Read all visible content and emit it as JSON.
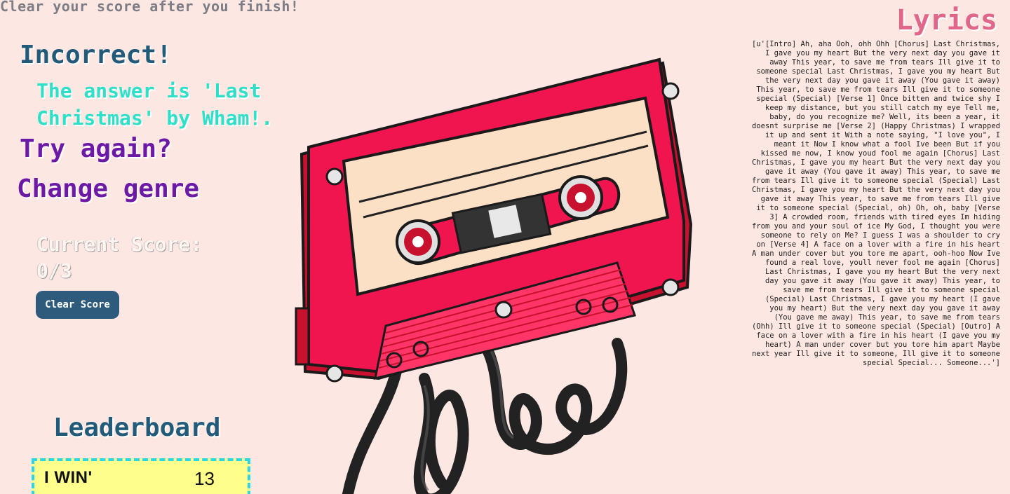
{
  "header": {
    "note": "Clear your score after you finish!"
  },
  "result": {
    "title": "Incorrect!",
    "answer": "The answer is 'Last Christmas' by Wham!."
  },
  "actions": {
    "try_again": "Try again?",
    "change_genre": "Change genre"
  },
  "score": {
    "label": "Current Score: 0/3",
    "clear_button": "Clear Score"
  },
  "leaderboard": {
    "title": "Leaderboard",
    "entries": [
      {
        "name": "I WIN'",
        "score": "13"
      }
    ]
  },
  "lyrics": {
    "title": "Lyrics",
    "text": "[u'[Intro] Ah, aha Ooh, ohh Ohh [Chorus] Last Christmas, I gave you my heart But the very next day you gave it away This year, to save me from tears Ill give it to someone special Last Christmas, I gave you my heart But the very next day you gave it away (You gave it away) This year, to save me from tears Ill give it to someone special (Special) [Verse 1] Once bitten and twice shy I keep my distance, but you still catch my eye Tell me, baby, do you recognize me? Well, its been a year, it doesnt surprise me [Verse 2] (Happy Christmas) I wrapped it up and sent it With a note saying, \"I love you\", I meant it Now I know what a fool Ive been But if you kissed me now, I know youd fool me again [Chorus] Last Christmas, I gave you my heart But the very next day you gave it away (You gave it away) This year, to save me from tears Ill give it to someone special (Special) Last Christmas, I gave you my heart But the very next day you gave it away This year, to save me from tears Ill give it to someone special (Special, oh) Oh, oh, baby [Verse 3] A crowded room, friends with tired eyes Im hiding from you and your soul of ice My God, I thought you were someone to rely on Me? I guess I was a shoulder to cry on [Verse 4] A face on a lover with a fire in his heart A man under cover but you tore me apart, ooh-hoo Now Ive found a real love, youll never fool me again [Chorus] Last Christmas, I gave you my heart But the very next day you gave it away (You gave it away) This year, to save me from tears Ill give it to someone special (Special) Last Christmas, I gave you my heart (I gave you my heart) But the very next day you gave it away (You gave me away) This year, to save me from tears (Ohh) Ill give it to someone special (Special) [Outro] A face on a lover with a fire in his heart (I gave you my heart) A man under cover but you tore him apart Maybe next year Ill give it to someone, Ill give it to someone special Special... Someone...']"
  },
  "illustration": {
    "icon": "cassette-tape-icon"
  },
  "colors": {
    "background": "#fde7e2",
    "title_blue": "#225a7a",
    "answer_teal": "#2fe0c9",
    "action_purple": "#6c1aa6",
    "lyrics_pink": "#e0678a",
    "button_blue": "#2e5b7c",
    "leaderboard_yellow": "#fefe8c",
    "leaderboard_border": "#2ad7e2",
    "cassette_red": "#f0154f"
  }
}
